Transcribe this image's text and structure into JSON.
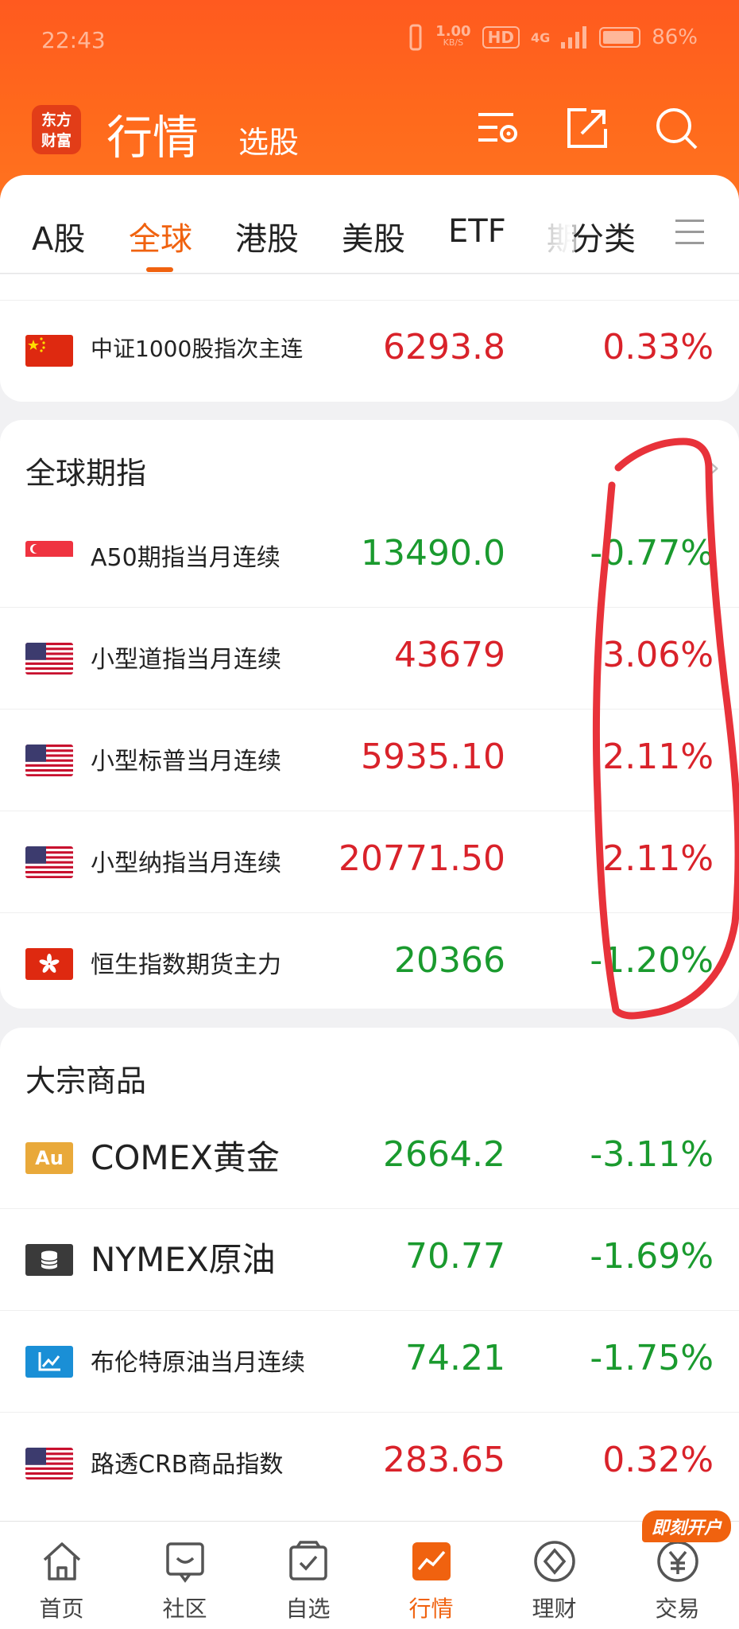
{
  "status_bar": {
    "time": "22:43",
    "net_speed_value": "1.00",
    "net_speed_unit": "KB/S",
    "hd": "HD",
    "signal": "4G",
    "battery": "86%"
  },
  "header": {
    "logo": "东方财富",
    "title": "行情",
    "subtitle": "选股"
  },
  "tabs": [
    {
      "label": "A股"
    },
    {
      "label": "全球"
    },
    {
      "label": "港股"
    },
    {
      "label": "美股"
    },
    {
      "label": "ETF"
    },
    {
      "label": "期"
    },
    {
      "label": "分类"
    }
  ],
  "top_row": {
    "name": "中证1000股指次主连",
    "price": "6293.8",
    "pct": "0.33%"
  },
  "futures": {
    "title": "全球期指",
    "rows": [
      {
        "name": "A50期指当月连续",
        "price": "13490.0",
        "pct": "-0.77%",
        "dir": "down",
        "flag": "sg"
      },
      {
        "name": "小型道指当月连续",
        "price": "43679",
        "pct": "3.06%",
        "dir": "up",
        "flag": "us"
      },
      {
        "name": "小型标普当月连续",
        "price": "5935.10",
        "pct": "2.11%",
        "dir": "up",
        "flag": "us"
      },
      {
        "name": "小型纳指当月连续",
        "price": "20771.50",
        "pct": "2.11%",
        "dir": "up",
        "flag": "us"
      },
      {
        "name": "恒生指数期货主力",
        "price": "20366",
        "pct": "-1.20%",
        "dir": "down",
        "flag": "hk"
      }
    ]
  },
  "commodities": {
    "title": "大宗商品",
    "rows": [
      {
        "name": "COMEX黄金",
        "price": "2664.2",
        "pct": "-3.11%",
        "dir": "down",
        "icon_text": "Au"
      },
      {
        "name": "NYMEX原油",
        "price": "70.77",
        "pct": "-1.69%",
        "dir": "down"
      },
      {
        "name": "布伦特原油当月连续",
        "price": "74.21",
        "pct": "-1.75%",
        "dir": "down"
      },
      {
        "name": "路透CRB商品指数",
        "price": "283.65",
        "pct": "0.32%",
        "dir": "up"
      }
    ]
  },
  "bottom_nav": [
    {
      "label": "首页"
    },
    {
      "label": "社区"
    },
    {
      "label": "自选"
    },
    {
      "label": "行情"
    },
    {
      "label": "理财"
    },
    {
      "label": "交易"
    }
  ],
  "open_account_badge": "即刻开户",
  "colors": {
    "accent": "#f0620f",
    "up": "#d9222a",
    "down": "#1a9a2e",
    "annotation": "#e8323a"
  }
}
